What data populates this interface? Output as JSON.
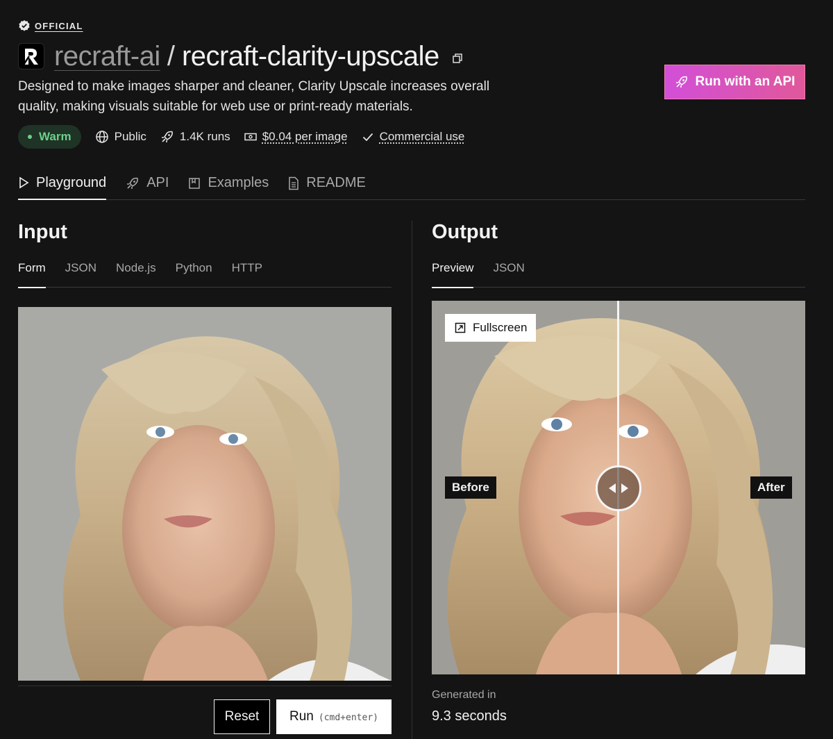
{
  "header": {
    "badge": "OFFICIAL",
    "owner": "recraft-ai",
    "separator": "/",
    "model": "recraft-clarity-upscale",
    "description": "Designed to make images sharper and cleaner, Clarity Upscale increases overall quality, making visuals suitable for web use or print-ready materials.",
    "api_button": "Run with an API"
  },
  "meta": {
    "status": "Warm",
    "visibility": "Public",
    "runs": "1.4K runs",
    "price": "$0.04 per image",
    "license": "Commercial use"
  },
  "tabs": [
    {
      "label": "Playground",
      "icon": "play-icon",
      "active": true
    },
    {
      "label": "API",
      "icon": "rocket-icon"
    },
    {
      "label": "Examples",
      "icon": "bookmark-icon"
    },
    {
      "label": "README",
      "icon": "document-icon"
    }
  ],
  "input": {
    "title": "Input",
    "tabs": [
      "Form",
      "JSON",
      "Node.js",
      "Python",
      "HTTP"
    ],
    "reset_label": "Reset",
    "run_label": "Run",
    "run_shortcut": "(cmd+enter)"
  },
  "output": {
    "title": "Output",
    "tabs": [
      "Preview",
      "JSON"
    ],
    "fullscreen_label": "Fullscreen",
    "before_label": "Before",
    "after_label": "After",
    "slider_position": 0.5,
    "generated_label": "Generated in",
    "generated_value": "9.3 seconds"
  },
  "colors": {
    "background": "#141414",
    "api_gradient_start": "#d24fd8",
    "api_gradient_end": "#e0589a",
    "warm_text": "#6ccf8a"
  }
}
